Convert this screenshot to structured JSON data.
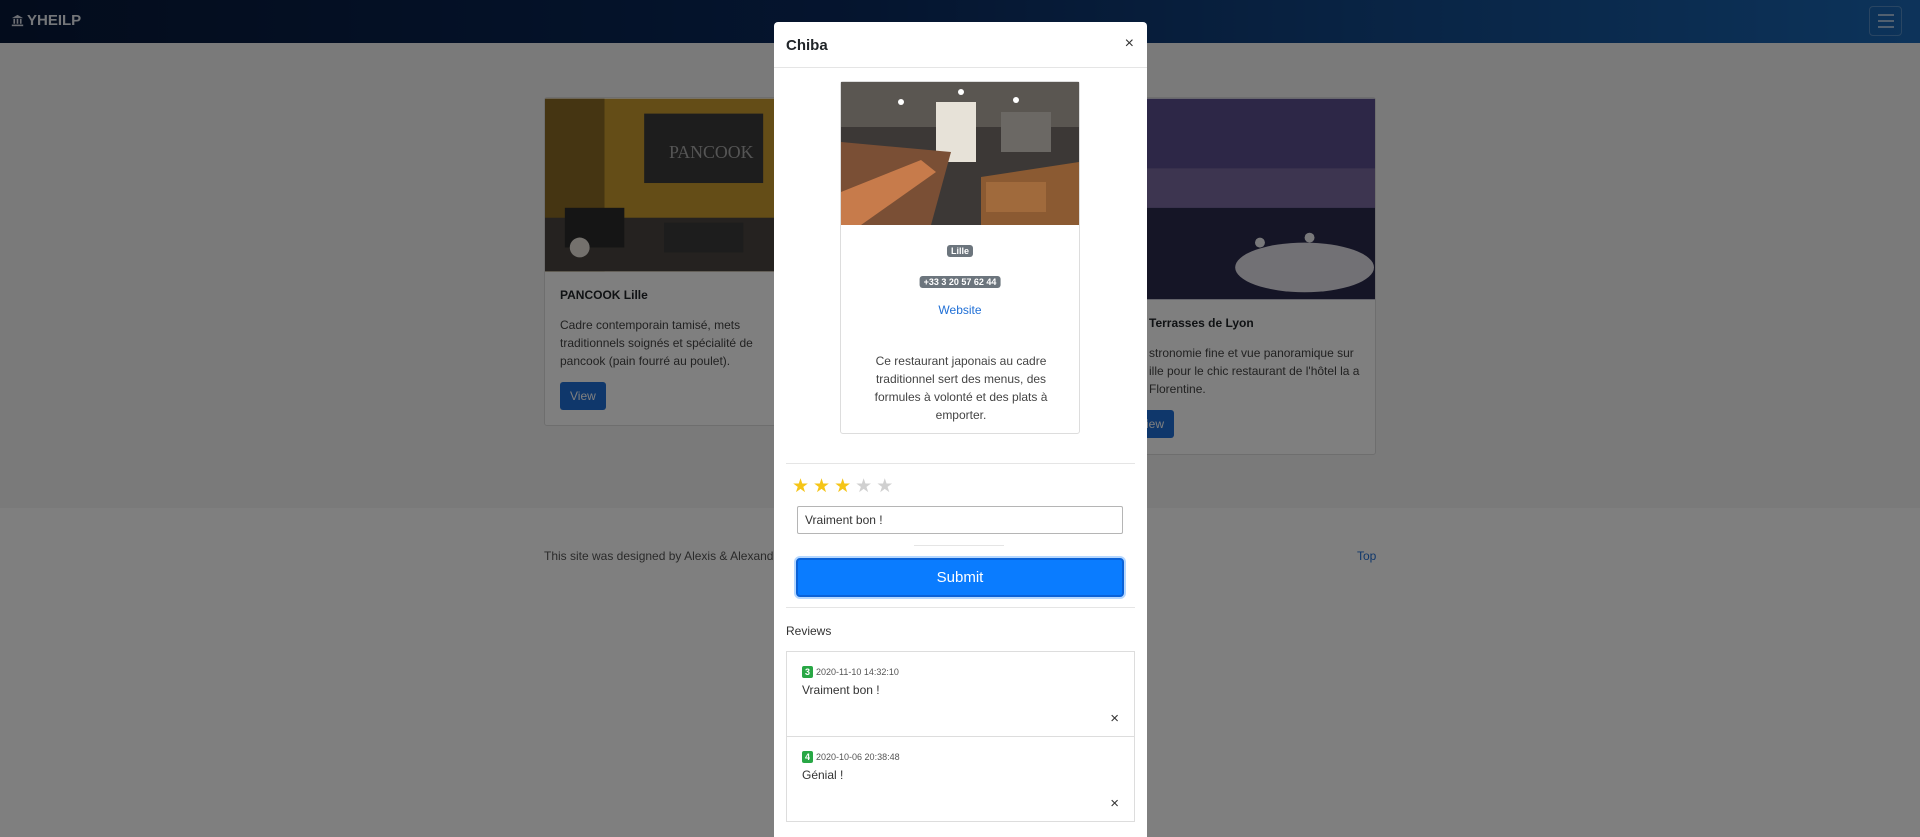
{
  "navbar": {
    "brand": "YHEILP"
  },
  "cards": [
    {
      "title": "PANCOOK Lille",
      "text": "Cadre contemporain tamisé, mets traditionnels soignés et spécialité de pancook (pain fourré au poulet).",
      "button": "View"
    },
    {
      "title": "Terrasses de Lyon",
      "text": "stronomie fine et vue panoramique sur ille pour le chic restaurant de l'hôtel la a Florentine.",
      "button": "iew"
    }
  ],
  "footer": {
    "credit": "This site was designed by Alexis & Alexandr",
    "top_link": "Top"
  },
  "modal": {
    "title": "Chiba",
    "close": "×",
    "city": "Lille",
    "phone": "+33 3 20 57 62 44",
    "website": "Website",
    "description": "Ce restaurant japonais au cadre traditionnel sert des menus, des formules à volonté et des plats à emporter.",
    "rating": 3,
    "rating_max": 5,
    "review_input_value": "Vraiment bon !",
    "submit": "Submit",
    "reviews_label": "Reviews",
    "reviews": [
      {
        "rating": "3",
        "date": "2020-11-10 14:32:10",
        "text": "Vraiment bon !",
        "delete": "×"
      },
      {
        "rating": "4",
        "date": "2020-10-06 20:38:48",
        "text": "Génial !",
        "delete": "×"
      }
    ]
  },
  "colors": {
    "accent": "#0a7cff",
    "star": "#f5c518",
    "badge_green": "#28a745",
    "badge_gray": "#6c757d"
  }
}
